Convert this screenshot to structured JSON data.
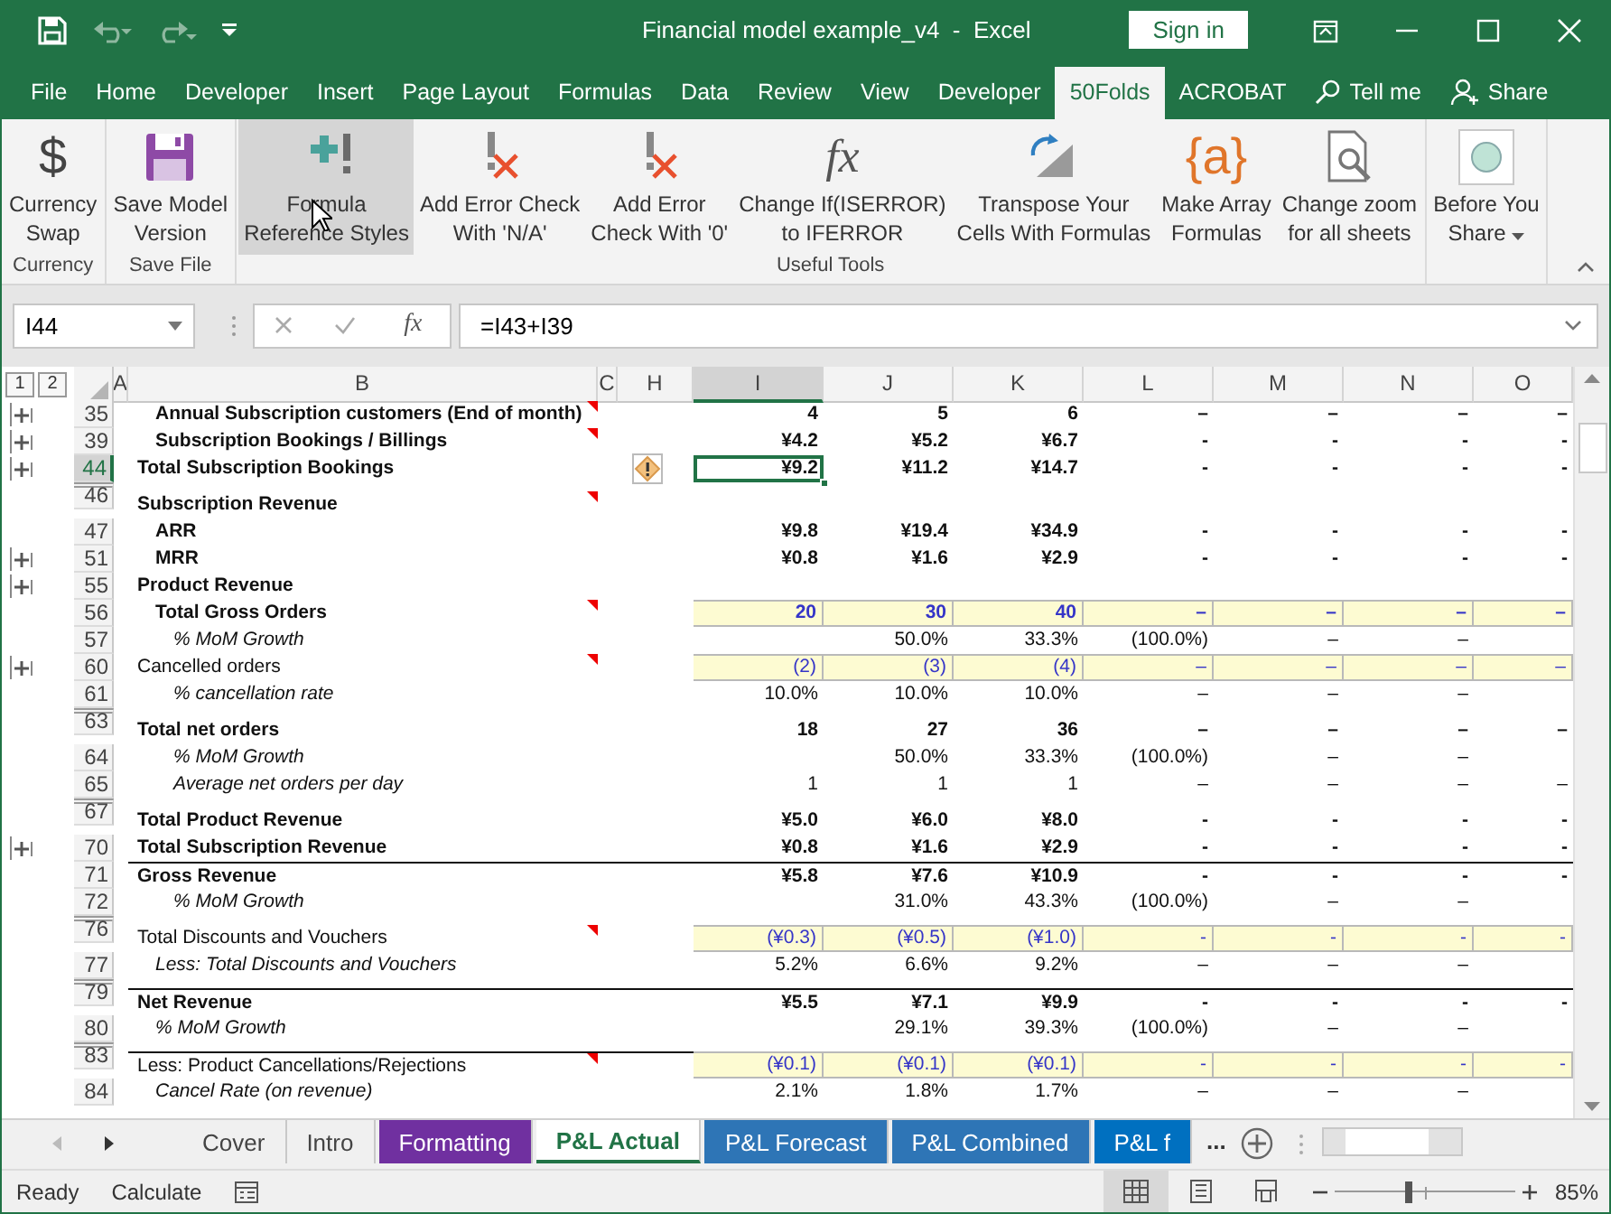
{
  "title_bar": {
    "title": "Financial model example_v4  -  Excel",
    "sign_in": "Sign in"
  },
  "menu_tabs": [
    {
      "label": "File",
      "selected": false
    },
    {
      "label": "Home",
      "selected": false
    },
    {
      "label": "Developer",
      "selected": false
    },
    {
      "label": "Insert",
      "selected": false
    },
    {
      "label": "Page Layout",
      "selected": false
    },
    {
      "label": "Formulas",
      "selected": false
    },
    {
      "label": "Data",
      "selected": false
    },
    {
      "label": "Review",
      "selected": false
    },
    {
      "label": "View",
      "selected": false
    },
    {
      "label": "Developer",
      "selected": false
    },
    {
      "label": "50Folds",
      "selected": true
    },
    {
      "label": "ACROBAT",
      "selected": false
    }
  ],
  "tell_me": "Tell me",
  "share": "Share",
  "ribbon": {
    "groups": [
      {
        "label": "Currency",
        "buttons": [
          {
            "label": "Currency\nSwap",
            "glyph": "$",
            "hovered": false
          }
        ]
      },
      {
        "label": "Save File",
        "buttons": [
          {
            "label": "Save Model\nVersion",
            "hovered": false
          }
        ]
      },
      {
        "label": "Useful Tools",
        "buttons": [
          {
            "label": "Formula\nReference Styles",
            "hovered": true
          },
          {
            "label": "Add Error Check\nWith 'N/A'",
            "hovered": false
          },
          {
            "label": "Add Error\nCheck With '0'",
            "hovered": false
          },
          {
            "label": "Change If(ISERROR)\nto IFERROR",
            "glyph": "fx",
            "hovered": false
          },
          {
            "label": "Transpose Your\nCells With Formulas",
            "hovered": false
          },
          {
            "label": "Make Array\nFormulas",
            "glyph": "{a}",
            "hovered": false
          },
          {
            "label": "Change zoom\nfor all sheets",
            "hovered": false
          }
        ]
      },
      {
        "buttons": [
          {
            "label": "Before You\nShare",
            "hovered": false,
            "menu": true
          }
        ]
      }
    ]
  },
  "formula_bar": {
    "name_box": "I44",
    "function_button": "fx",
    "formula": "=I43+I39"
  },
  "sheet": {
    "outline_levels": [
      "1",
      "2"
    ],
    "columns": [
      {
        "label": "A",
        "selected": false
      },
      {
        "label": "B",
        "selected": false
      },
      {
        "label": "C",
        "selected": false
      },
      {
        "label": "H",
        "selected": false
      },
      {
        "label": "I",
        "selected": true
      },
      {
        "label": "J",
        "selected": false
      },
      {
        "label": "K",
        "selected": false
      },
      {
        "label": "L",
        "selected": false
      },
      {
        "label": "M",
        "selected": false
      },
      {
        "label": "N",
        "selected": false
      },
      {
        "label": "O",
        "selected": false
      }
    ],
    "rows": [
      {
        "number": "35",
        "label": "Annual Subscription customers (End of month)",
        "kind": "item",
        "selected": false,
        "collapsed": true,
        "comment": true,
        "cells": [
          "4",
          "5",
          "6",
          "–",
          "–",
          "–",
          "–"
        ]
      },
      {
        "number": "39",
        "label": "Subscription Bookings / Billings",
        "kind": "item",
        "selected": false,
        "collapsed": true,
        "comment": true,
        "cells": [
          "¥4.2",
          "¥5.2",
          "¥6.7",
          "-",
          "-",
          "-",
          "-"
        ]
      },
      {
        "number": "44",
        "label": "Total Subscription Bookings",
        "kind": "heading",
        "selected": true,
        "collapsed": true,
        "warning": true,
        "cells": [
          "¥9.2",
          "¥11.2",
          "¥14.7",
          "-",
          "-",
          "-",
          "-"
        ]
      },
      {
        "number": "46",
        "label": "Subscription Revenue",
        "kind": "heading",
        "selected": false,
        "gap_above": true,
        "comment": true,
        "cells": []
      },
      {
        "number": "47",
        "label": "ARR",
        "kind": "item",
        "selected": false,
        "cells": [
          "¥9.8",
          "¥19.4",
          "¥34.9",
          "-",
          "-",
          "-",
          "-"
        ]
      },
      {
        "number": "51",
        "label": "MRR",
        "kind": "item",
        "selected": false,
        "collapsed": true,
        "cells": [
          "¥0.8",
          "¥1.6",
          "¥2.9",
          "-",
          "-",
          "-",
          "-"
        ]
      },
      {
        "number": "55",
        "label": "Product Revenue",
        "kind": "heading",
        "selected": false,
        "collapsed": true,
        "cells": []
      },
      {
        "number": "56",
        "label": "Total Gross Orders",
        "kind": "item",
        "selected": false,
        "comment": true,
        "input": true,
        "cells": [
          "20",
          "30",
          "40",
          "–",
          "–",
          "–",
          "–"
        ]
      },
      {
        "number": "57",
        "label": "% MoM Growth",
        "kind": "percent",
        "selected": false,
        "cells": [
          "",
          "50.0%",
          "33.3%",
          "(100.0%)",
          "–",
          "–",
          ""
        ]
      },
      {
        "number": "60",
        "label": "Cancelled orders",
        "kind": "input",
        "selected": false,
        "collapsed": true,
        "comment": true,
        "input": true,
        "cells": [
          "(2)",
          "(3)",
          "(4)",
          "–",
          "–",
          "–",
          "–"
        ]
      },
      {
        "number": "61",
        "label": "% cancellation rate",
        "kind": "percent",
        "selected": false,
        "cells": [
          "10.0%",
          "10.0%",
          "10.0%",
          "–",
          "–",
          "–",
          ""
        ]
      },
      {
        "number": "63",
        "label": "Total net orders",
        "kind": "heading",
        "selected": false,
        "gap_above": true,
        "cells": [
          "18",
          "27",
          "36",
          "–",
          "–",
          "–",
          "–"
        ]
      },
      {
        "number": "64",
        "label": "% MoM Growth",
        "kind": "percent",
        "selected": false,
        "cells": [
          "",
          "50.0%",
          "33.3%",
          "(100.0%)",
          "–",
          "–",
          ""
        ]
      },
      {
        "number": "65",
        "label": "Average net orders per day",
        "kind": "percent",
        "selected": false,
        "cells": [
          "1",
          "1",
          "1",
          "–",
          "–",
          "–",
          "–"
        ]
      },
      {
        "number": "67",
        "label": "Total Product Revenue",
        "kind": "heading",
        "selected": false,
        "gap_above": true,
        "cells": [
          "¥5.0",
          "¥6.0",
          "¥8.0",
          "-",
          "-",
          "-",
          "-"
        ]
      },
      {
        "number": "70",
        "label": "Total Subscription Revenue",
        "kind": "heading",
        "selected": false,
        "collapsed": true,
        "cells": [
          "¥0.8",
          "¥1.6",
          "¥2.9",
          "-",
          "-",
          "-",
          "-"
        ]
      },
      {
        "number": "71",
        "label": "Gross Revenue",
        "kind": "heading",
        "selected": false,
        "rule_above": true,
        "cells": [
          "¥5.8",
          "¥7.6",
          "¥10.9",
          "-",
          "-",
          "-",
          "-"
        ]
      },
      {
        "number": "72",
        "label": "% MoM Growth",
        "kind": "percent",
        "selected": false,
        "cells": [
          "",
          "31.0%",
          "43.3%",
          "(100.0%)",
          "–",
          "–",
          ""
        ]
      },
      {
        "number": "76",
        "label": "Total Discounts and Vouchers",
        "kind": "input",
        "selected": false,
        "gap_above": true,
        "comment": true,
        "input": true,
        "cells": [
          "(¥0.3)",
          "(¥0.5)",
          "(¥1.0)",
          "-",
          "-",
          "-",
          "-"
        ]
      },
      {
        "number": "77",
        "label": "Less: Total Discounts and Vouchers",
        "kind": "note",
        "selected": false,
        "cells": [
          "5.2%",
          "6.6%",
          "9.2%",
          "–",
          "–",
          "–",
          ""
        ]
      },
      {
        "number": "79",
        "label": "Net Revenue",
        "kind": "heading",
        "selected": false,
        "gap_above": true,
        "rule_above": true,
        "cells": [
          "¥5.5",
          "¥7.1",
          "¥9.9",
          "-",
          "-",
          "-",
          "-"
        ]
      },
      {
        "number": "80",
        "label": "% MoM Growth",
        "kind": "note",
        "selected": false,
        "cells": [
          "",
          "29.1%",
          "39.3%",
          "(100.0%)",
          "–",
          "–",
          ""
        ]
      },
      {
        "number": "83",
        "label": "Less: Product Cancellations/Rejections",
        "kind": "input",
        "selected": false,
        "gap_above": true,
        "rule_above": true,
        "comment": true,
        "input": true,
        "cells": [
          "(¥0.1)",
          "(¥0.1)",
          "(¥0.1)",
          "-",
          "-",
          "-",
          "-"
        ]
      },
      {
        "number": "84",
        "label": "Cancel Rate (on revenue)",
        "kind": "note",
        "selected": false,
        "cells": [
          "2.1%",
          "1.8%",
          "1.7%",
          "–",
          "–",
          "–",
          ""
        ]
      }
    ]
  },
  "sheet_tabs": {
    "tabs": [
      {
        "label": "Cover",
        "selected": false
      },
      {
        "label": "Intro",
        "selected": false
      },
      {
        "label": "Formatting",
        "selected": false,
        "color": "#7030a0"
      },
      {
        "label": "P&L Actual",
        "selected": true
      },
      {
        "label": "P&L Forecast",
        "selected": false,
        "color": "#2e75b6"
      },
      {
        "label": "P&L Combined",
        "selected": false,
        "color": "#2e75b6"
      },
      {
        "label": "P&L f",
        "selected": false,
        "color": "#0070c0"
      }
    ],
    "more": "..."
  },
  "status_bar": {
    "mode": "Ready",
    "calculate": "Calculate",
    "zoom": {
      "level": 0.41,
      "reading": "85%"
    }
  }
}
